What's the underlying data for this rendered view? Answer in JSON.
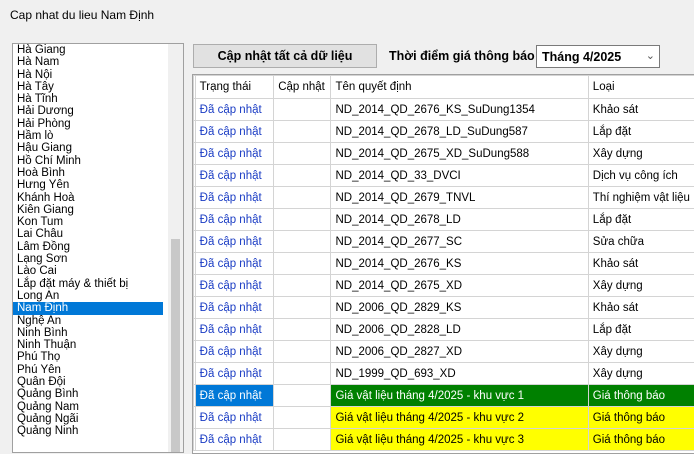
{
  "window": {
    "title": "Cap nhat du lieu Nam Định"
  },
  "provinces": {
    "items": [
      "Hà Giang",
      "Hà Nam",
      "Hà Nội",
      "Hà Tây",
      "Hà Tĩnh",
      "Hải Dương",
      "Hải Phòng",
      "Hầm lò",
      "Hậu Giang",
      "Hồ Chí Minh",
      "Hoà Bình",
      "Hưng Yên",
      "Khánh Hoà",
      "Kiên Giang",
      "Kon Tum",
      "Lai Châu",
      "Lâm Đồng",
      "Lạng Sơn",
      "Lào Cai",
      "Lắp đặt máy & thiết bị",
      "Long An",
      "Nam Định",
      "Nghệ An",
      "Ninh Bình",
      "Ninh Thuận",
      "Phú Thọ",
      "Phú Yên",
      "Quân Đội",
      "Quảng Bình",
      "Quảng Nam",
      "Quảng Ngãi",
      "Quảng Ninh"
    ],
    "selected": "Nam Định"
  },
  "toolbar": {
    "update_all_label": "Cập nhật tất cả dữ liệu",
    "time_label": "Thời điểm giá thông báo",
    "time_value": "Tháng 4/2025"
  },
  "grid": {
    "columns": [
      "Trạng thái",
      "Cập nhật",
      "Tên quyết định",
      "Loại"
    ],
    "rows": [
      {
        "status": "Đã cập nhật",
        "update": "",
        "name": "ND_2014_QD_2676_KS_SuDung1354",
        "type": "Khảo sát"
      },
      {
        "status": "Đã cập nhật",
        "update": "",
        "name": "ND_2014_QD_2678_LD_SuDung587",
        "type": "Lắp đặt"
      },
      {
        "status": "Đã cập nhật",
        "update": "",
        "name": "ND_2014_QD_2675_XD_SuDung588",
        "type": "Xây dựng"
      },
      {
        "status": "Đã cập nhật",
        "update": "",
        "name": "ND_2014_QD_33_DVCI",
        "type": "Dịch vụ công ích"
      },
      {
        "status": "Đã cập nhật",
        "update": "",
        "name": "ND_2014_QD_2679_TNVL",
        "type": "Thí nghiệm vật liệu"
      },
      {
        "status": "Đã cập nhật",
        "update": "",
        "name": "ND_2014_QD_2678_LD",
        "type": "Lắp đặt"
      },
      {
        "status": "Đã cập nhật",
        "update": "",
        "name": "ND_2014_QD_2677_SC",
        "type": "Sửa chữa"
      },
      {
        "status": "Đã cập nhật",
        "update": "",
        "name": "ND_2014_QD_2676_KS",
        "type": "Khảo sát"
      },
      {
        "status": "Đã cập nhật",
        "update": "",
        "name": "ND_2014_QD_2675_XD",
        "type": "Xây dựng"
      },
      {
        "status": "Đã cập nhật",
        "update": "",
        "name": "ND_2006_QD_2829_KS",
        "type": "Khảo sát"
      },
      {
        "status": "Đã cập nhật",
        "update": "",
        "name": "ND_2006_QD_2828_LD",
        "type": "Lắp đặt"
      },
      {
        "status": "Đã cập nhật",
        "update": "",
        "name": "ND_2006_QD_2827_XD",
        "type": "Xây dựng"
      },
      {
        "status": "Đã cập nhật",
        "update": "",
        "name": "ND_1999_QD_693_XD",
        "type": "Xây dựng"
      },
      {
        "status": "Đã cập nhật",
        "update": "",
        "name": "Giá vật liệu tháng 4/2025 - khu vực 1",
        "type": "Giá thông báo",
        "highlight": "green",
        "selected": true
      },
      {
        "status": "Đã cập nhật",
        "update": "",
        "name": "Giá vật liệu tháng 4/2025 - khu vực 2",
        "type": "Giá thông báo",
        "highlight": "yellow"
      },
      {
        "status": "Đã cập nhật",
        "update": "",
        "name": "Giá vật liệu tháng 4/2025 - khu vực 3",
        "type": "Giá thông báo",
        "highlight": "yellow"
      }
    ]
  },
  "colors": {
    "selection": "#0078d7",
    "status_text": "#1a3cc4",
    "highlight_green": "#008000",
    "highlight_yellow": "#ffff00"
  }
}
